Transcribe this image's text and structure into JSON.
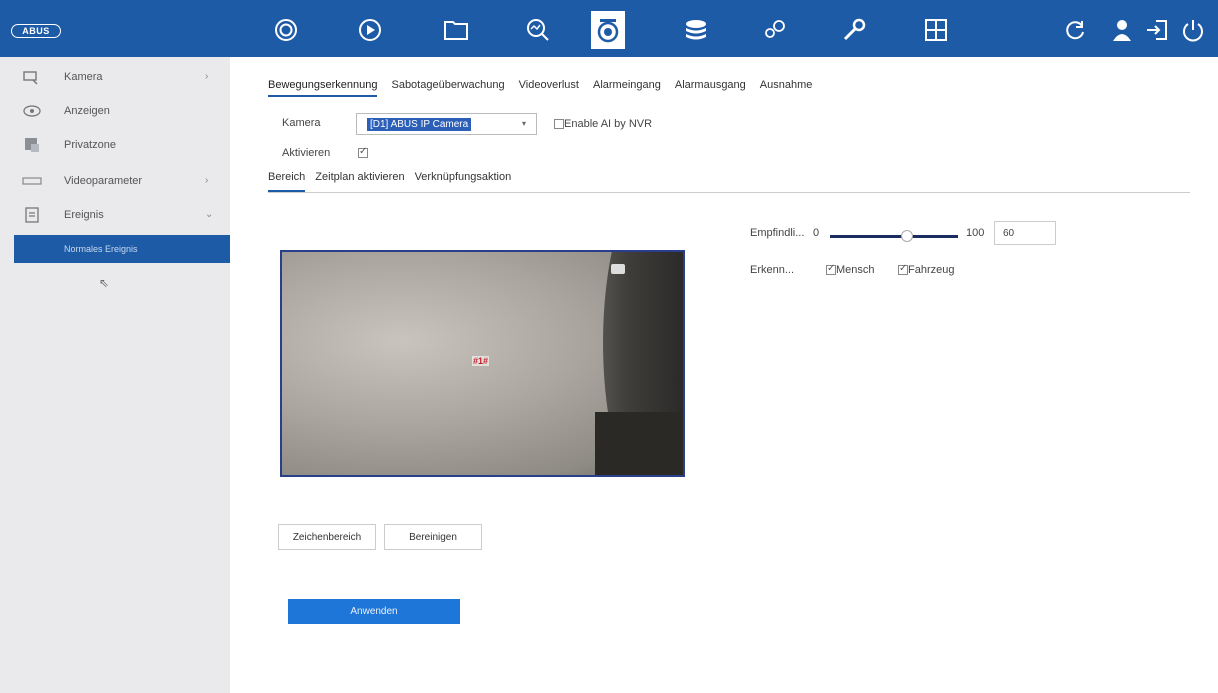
{
  "brand": {
    "logo_text": "ABUS"
  },
  "topnav": {
    "items": [
      {
        "icon": "live-view-icon"
      },
      {
        "icon": "playback-icon"
      },
      {
        "icon": "files-icon"
      },
      {
        "icon": "smart-search-icon"
      },
      {
        "icon": "camera-icon",
        "active": true
      },
      {
        "icon": "storage-icon"
      },
      {
        "icon": "system-settings-icon"
      },
      {
        "icon": "maintenance-icon"
      },
      {
        "icon": "grid-icon"
      }
    ],
    "right_icons": [
      "refresh-icon",
      "user-icon",
      "logout-icon",
      "power-icon"
    ]
  },
  "sidebar": {
    "items": [
      {
        "label": "Kamera",
        "icon": "camera-icon",
        "chevron": "›"
      },
      {
        "label": "Anzeigen",
        "icon": "eye-icon"
      },
      {
        "label": "Privatzone",
        "icon": "privacy-icon"
      },
      {
        "label": "Videoparameter",
        "icon": "video-param-icon",
        "chevron": "›"
      },
      {
        "label": "Ereignis",
        "icon": "event-icon",
        "chevron": "⌄"
      }
    ],
    "subitem": "Normales Ereignis"
  },
  "main": {
    "tabs": [
      "Bewegungserkennung",
      "Sabotageüberwachung",
      "Videoverlust",
      "Alarmeingang",
      "Alarmausgang",
      "Ausnahme"
    ],
    "camera_label": "Kamera",
    "camera_value": "[D1] ABUS IP Camera",
    "enable_ai_label": "Enable AI by NVR",
    "activate_label": "Aktivieren",
    "subtabs": [
      "Bereich",
      "Zeitplan aktivieren",
      "Verknüpfungsaktion"
    ],
    "video": {
      "zone_label": "#1#"
    },
    "sensitivity": {
      "label": "Empfindli...",
      "min": "0",
      "max": "100",
      "value": "60",
      "level": 0.6
    },
    "detection": {
      "label": "Erkenn...",
      "human": "Mensch",
      "vehicle": "Fahrzeug"
    },
    "buttons": {
      "draw": "Zeichenbereich",
      "clear": "Bereinigen",
      "apply": "Anwenden"
    }
  }
}
